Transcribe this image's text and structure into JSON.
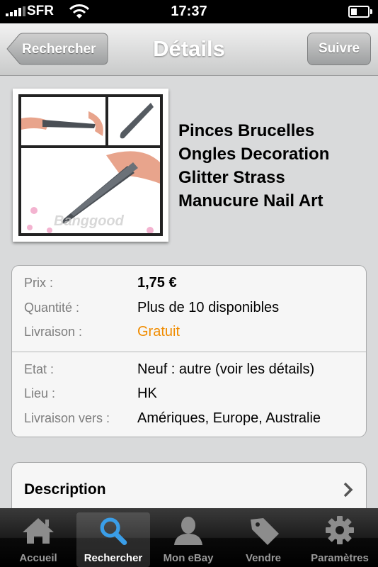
{
  "status_bar": {
    "carrier": "SFR",
    "time": "17:37"
  },
  "nav": {
    "back_label": "Rechercher",
    "title": "Détails",
    "follow_label": "Suivre"
  },
  "product": {
    "title": "Pinces Brucelles Ongles Decoration Glitter Strass Manucure Nail Art",
    "image_watermark": "Banggood"
  },
  "details": [
    {
      "label": "Prix :",
      "value": "1,75 €"
    },
    {
      "label": "Quantité :",
      "value": "Plus de 10 disponibles"
    },
    {
      "label": "Livraison :",
      "value": "Gratuit"
    },
    {
      "label": "Etat :",
      "value": "Neuf : autre (voir les détails)"
    },
    {
      "label": "Lieu :",
      "value": "HK"
    },
    {
      "label": "Livraison vers :",
      "value": "Amériques, Europe, Australie"
    }
  ],
  "description_label": "Description",
  "tabs": [
    {
      "label": "Accueil",
      "icon": "home-icon"
    },
    {
      "label": "Rechercher",
      "icon": "search-icon",
      "active": true
    },
    {
      "label": "Mon eBay",
      "icon": "person-icon"
    },
    {
      "label": "Vendre",
      "icon": "tag-icon"
    },
    {
      "label": "Paramètres",
      "icon": "gear-icon"
    }
  ],
  "colors": {
    "free_shipping": "#f08c00",
    "nav_gradient_top": "#f2f2f2",
    "tab_active_icon": "#3a9ee8"
  }
}
